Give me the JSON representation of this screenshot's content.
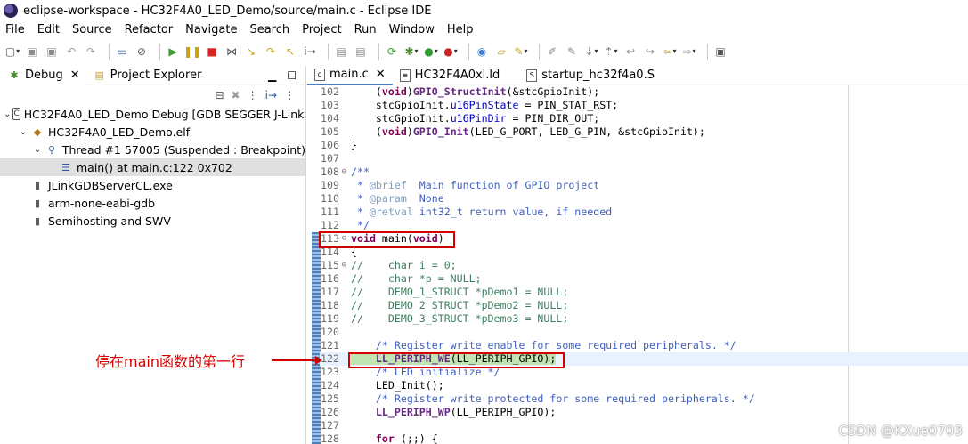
{
  "window": {
    "title": "eclipse-workspace - HC32F4A0_LED_Demo/source/main.c - Eclipse IDE"
  },
  "menu": [
    "File",
    "Edit",
    "Source",
    "Refactor",
    "Navigate",
    "Search",
    "Project",
    "Run",
    "Window",
    "Help"
  ],
  "left": {
    "tabs": [
      {
        "label": "Debug",
        "icon": "debug-bug-icon"
      },
      {
        "label": "Project Explorer",
        "icon": "project-explorer-icon"
      }
    ],
    "tree": [
      {
        "label": "HC32F4A0_LED_Demo Debug [GDB SEGGER J-Link D",
        "icon": "launch-config-icon",
        "twisty": "v"
      },
      {
        "label": "HC32F4A0_LED_Demo.elf",
        "icon": "elf-icon",
        "twisty": "v"
      },
      {
        "label": "Thread #1 57005 (Suspended : Breakpoint)",
        "icon": "thread-icon",
        "twisty": "v"
      },
      {
        "label": "main() at main.c:122 0x702",
        "icon": "stack-frame-icon",
        "twisty": ""
      },
      {
        "label": "JLinkGDBServerCL.exe",
        "icon": "process-icon",
        "twisty": ""
      },
      {
        "label": "arm-none-eabi-gdb",
        "icon": "process-icon",
        "twisty": ""
      },
      {
        "label": "Semihosting and SWV",
        "icon": "process-icon",
        "twisty": ""
      }
    ]
  },
  "editor": {
    "tabs": [
      {
        "label": "main.c",
        "active": true
      },
      {
        "label": "HC32F4A0xl.ld",
        "active": false
      },
      {
        "label": "startup_hc32f4a0.S",
        "active": false
      }
    ],
    "lines": [
      {
        "n": "102",
        "text": "    (void)GPIO_StructInit(&stcGpioInit);"
      },
      {
        "n": "103",
        "text": "    stcGpioInit.u16PinState = PIN_STAT_RST;"
      },
      {
        "n": "104",
        "text": "    stcGpioInit.u16PinDir = PIN_DIR_OUT;"
      },
      {
        "n": "105",
        "text": "    (void)GPIO_Init(LED_G_PORT, LED_G_PIN, &stcGpioInit);"
      },
      {
        "n": "106",
        "text": "}"
      },
      {
        "n": "107",
        "text": ""
      },
      {
        "n": "108",
        "text": "/**"
      },
      {
        "n": "109",
        "text": " * @brief  Main function of GPIO project"
      },
      {
        "n": "110",
        "text": " * @param  None"
      },
      {
        "n": "111",
        "text": " * @retval int32_t return value, if needed"
      },
      {
        "n": "112",
        "text": " */"
      },
      {
        "n": "113",
        "text": "void main(void)"
      },
      {
        "n": "114",
        "text": "{"
      },
      {
        "n": "115",
        "text": "//    char i = 0;"
      },
      {
        "n": "116",
        "text": "//    char *p = NULL;"
      },
      {
        "n": "117",
        "text": "//    DEMO_1_STRUCT *pDemo1 = NULL;"
      },
      {
        "n": "118",
        "text": "//    DEMO_2_STRUCT *pDemo2 = NULL;"
      },
      {
        "n": "119",
        "text": "//    DEMO_3_STRUCT *pDemo3 = NULL;"
      },
      {
        "n": "120",
        "text": ""
      },
      {
        "n": "121",
        "text": "    /* Register write enable for some required peripherals. */"
      },
      {
        "n": "122",
        "text": "    LL_PERIPH_WE(LL_PERIPH_GPIO);"
      },
      {
        "n": "123",
        "text": "    /* LED initialize */"
      },
      {
        "n": "124",
        "text": "    LED_Init();"
      },
      {
        "n": "125",
        "text": "    /* Register write protected for some required peripherals. */"
      },
      {
        "n": "126",
        "text": "    LL_PERIPH_WP(LL_PERIPH_GPIO);"
      },
      {
        "n": "127",
        "text": ""
      },
      {
        "n": "128",
        "text": "    for (;;) {"
      }
    ]
  },
  "annotation": {
    "text": "停在main函数的第一行"
  },
  "watermark": "CSDN @KXue0703",
  "colors": {
    "annotation": "#d40000",
    "keyword": "#7f0055",
    "comment": "#3f7f5f",
    "field": "#0000c0",
    "current_line": "#c2e3b2"
  }
}
